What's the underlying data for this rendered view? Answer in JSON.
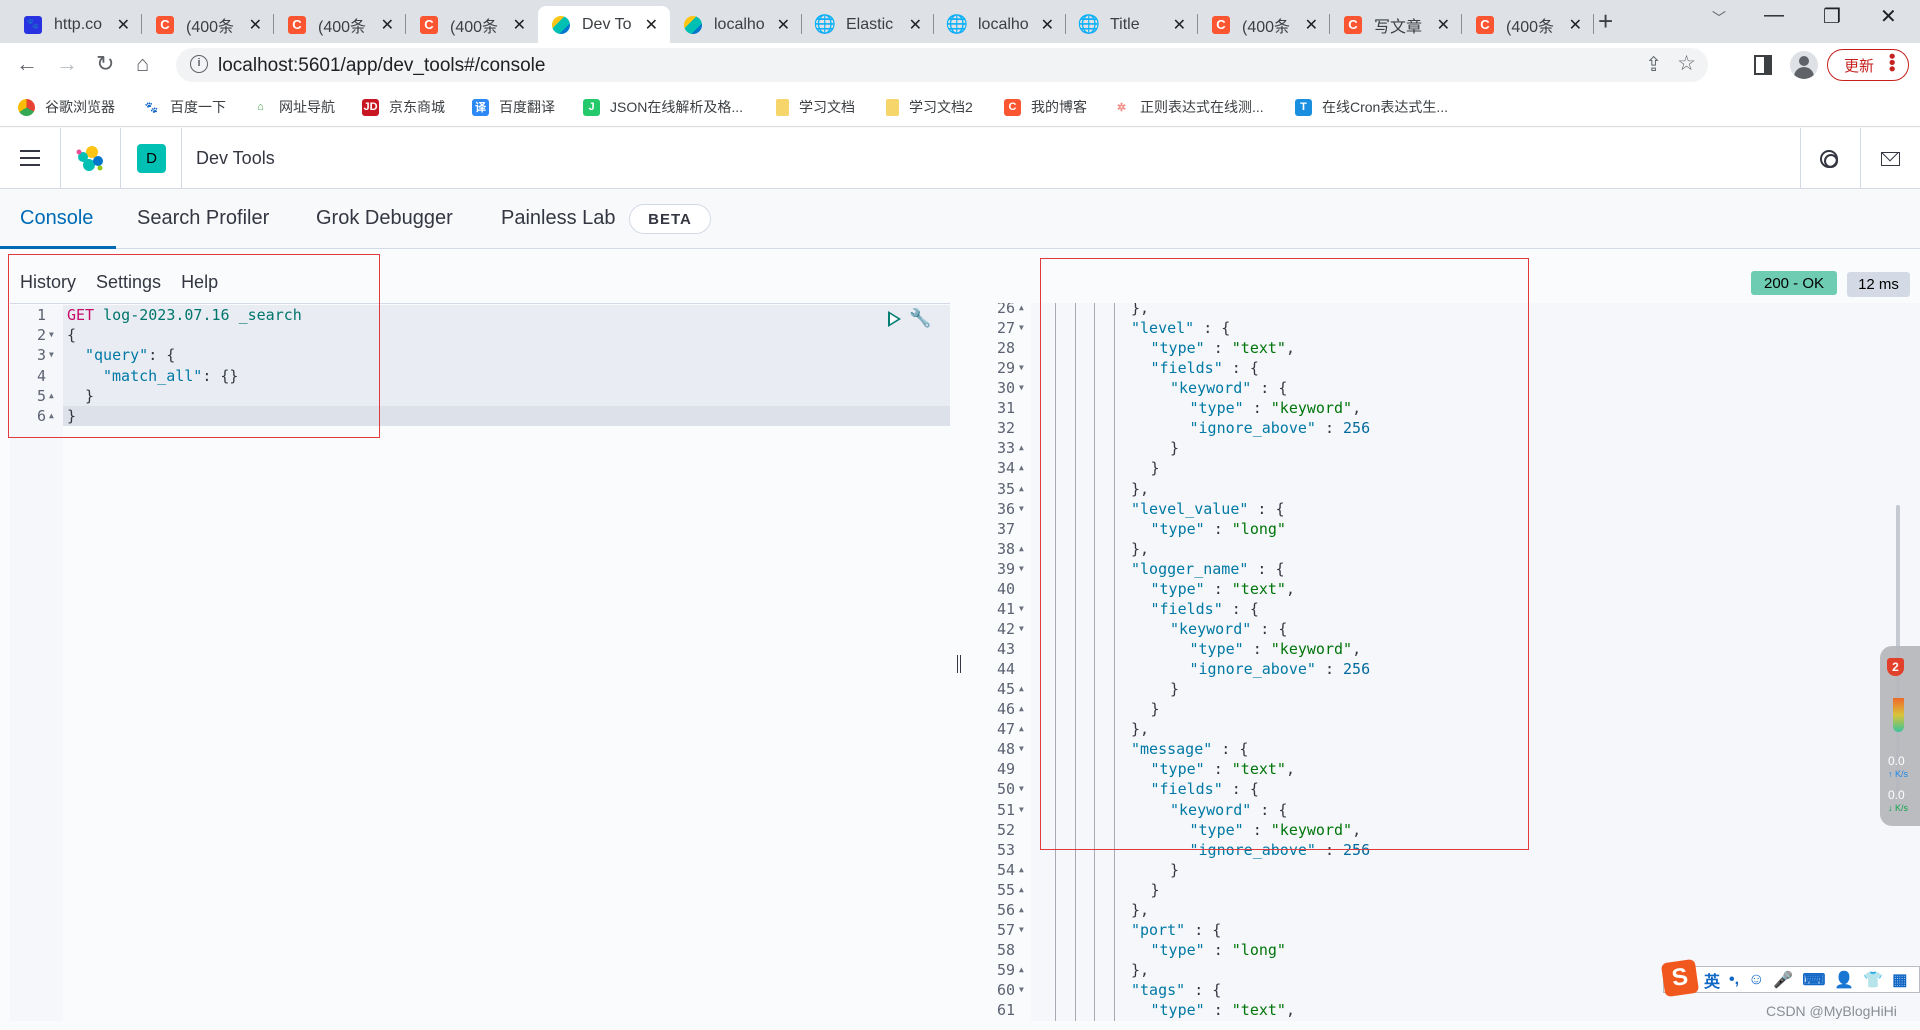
{
  "browser": {
    "tabs": [
      {
        "title": "http.co",
        "icon": "baidu-paw-icon"
      },
      {
        "title": "(400条",
        "icon": "csdn-icon"
      },
      {
        "title": "(400条",
        "icon": "csdn-icon"
      },
      {
        "title": "(400条",
        "icon": "csdn-icon"
      },
      {
        "title": "Dev To",
        "icon": "elastic-icon",
        "active": true
      },
      {
        "title": "localho",
        "icon": "elastic-icon"
      },
      {
        "title": "Elastic",
        "icon": "globe-icon"
      },
      {
        "title": "localho",
        "icon": "globe-icon"
      },
      {
        "title": "Title",
        "icon": "globe-icon"
      },
      {
        "title": "(400条",
        "icon": "csdn-icon"
      },
      {
        "title": "写文章",
        "icon": "csdn-icon"
      },
      {
        "title": "(400条",
        "icon": "csdn-icon"
      }
    ],
    "close_glyph": "✕",
    "new_tab_glyph": "+",
    "url": "localhost:5601/app/dev_tools#/console",
    "update_label": "更新",
    "bookmarks": [
      {
        "label": "谷歌浏览器",
        "icon": "chrome-icon",
        "color": "#e94235"
      },
      {
        "label": "百度一下",
        "icon": "baidu-paw-icon",
        "color": "#2932e1"
      },
      {
        "label": "网址导航",
        "icon": "2345-icon",
        "color": "#3fa34d"
      },
      {
        "label": "京东商城",
        "icon": "jd-icon",
        "color": "#c91623"
      },
      {
        "label": "百度翻译",
        "icon": "translate-icon",
        "color": "#2b88f5"
      },
      {
        "label": "JSON在线解析及格...",
        "icon": "json-icon",
        "color": "#23c96a"
      },
      {
        "label": "学习文档",
        "icon": "folder-icon",
        "color": "#f6d56b"
      },
      {
        "label": "学习文档2",
        "icon": "folder-icon",
        "color": "#f6d56b"
      },
      {
        "label": "我的博客",
        "icon": "csdn-icon",
        "color": "#fc5531"
      },
      {
        "label": "正则表达式在线测...",
        "icon": "regex-icon",
        "color": "#f08a80"
      },
      {
        "label": "在线Cron表达式生...",
        "icon": "cron-icon",
        "color": "#1a8fe0"
      }
    ]
  },
  "kibana": {
    "space_initial": "D",
    "app_title": "Dev Tools",
    "tabs": [
      {
        "label": "Console",
        "active": true
      },
      {
        "label": "Search Profiler"
      },
      {
        "label": "Grok Debugger"
      },
      {
        "label": "Painless Lab"
      }
    ],
    "beta_label": "BETA",
    "menu": [
      "History",
      "Settings",
      "Help"
    ],
    "status": {
      "code_label": "200 - OK",
      "time_label": "12 ms",
      "ok_color": "#6dccb1"
    }
  },
  "request": {
    "lines": [
      {
        "n": "1",
        "fold": "",
        "indent": 0,
        "tokens": [
          {
            "t": "GET ",
            "c": "kw-method"
          },
          {
            "t": "log-2023.07.16 _search",
            "c": "kw-url"
          }
        ]
      },
      {
        "n": "2",
        "fold": "▼",
        "indent": 0,
        "tokens": [
          {
            "t": "{",
            "c": ""
          }
        ]
      },
      {
        "n": "3",
        "fold": "▼",
        "indent": 1,
        "tokens": [
          {
            "t": "\"query\"",
            "c": "kw-key"
          },
          {
            "t": ": {",
            "c": ""
          }
        ]
      },
      {
        "n": "4",
        "fold": "",
        "indent": 2,
        "tokens": [
          {
            "t": "\"match_all\"",
            "c": "kw-key"
          },
          {
            "t": ": {}",
            "c": ""
          }
        ]
      },
      {
        "n": "5",
        "fold": "▲",
        "indent": 1,
        "tokens": [
          {
            "t": "}",
            "c": ""
          }
        ]
      },
      {
        "n": "6",
        "fold": "▲",
        "indent": 0,
        "tokens": [
          {
            "t": "}",
            "c": ""
          }
        ]
      }
    ]
  },
  "response": {
    "lines": [
      {
        "n": "26",
        "fold": "▲",
        "indent": 4,
        "tokens": [
          {
            "t": "},",
            "c": ""
          }
        ]
      },
      {
        "n": "27",
        "fold": "▼",
        "indent": 4,
        "tokens": [
          {
            "t": "\"level\"",
            "c": "kw-key"
          },
          {
            "t": " : {",
            "c": ""
          }
        ]
      },
      {
        "n": "28",
        "fold": "",
        "indent": 5,
        "tokens": [
          {
            "t": "\"type\"",
            "c": "kw-key"
          },
          {
            "t": " : ",
            "c": ""
          },
          {
            "t": "\"text\"",
            "c": "kw-str"
          },
          {
            "t": ",",
            "c": ""
          }
        ]
      },
      {
        "n": "29",
        "fold": "▼",
        "indent": 5,
        "tokens": [
          {
            "t": "\"fields\"",
            "c": "kw-key"
          },
          {
            "t": " : {",
            "c": ""
          }
        ]
      },
      {
        "n": "30",
        "fold": "▼",
        "indent": 6,
        "tokens": [
          {
            "t": "\"keyword\"",
            "c": "kw-key"
          },
          {
            "t": " : {",
            "c": ""
          }
        ]
      },
      {
        "n": "31",
        "fold": "",
        "indent": 7,
        "tokens": [
          {
            "t": "\"type\"",
            "c": "kw-key"
          },
          {
            "t": " : ",
            "c": ""
          },
          {
            "t": "\"keyword\"",
            "c": "kw-str"
          },
          {
            "t": ",",
            "c": ""
          }
        ]
      },
      {
        "n": "32",
        "fold": "",
        "indent": 7,
        "tokens": [
          {
            "t": "\"ignore_above\"",
            "c": "kw-key"
          },
          {
            "t": " : ",
            "c": ""
          },
          {
            "t": "256",
            "c": "kw-num"
          }
        ]
      },
      {
        "n": "33",
        "fold": "▲",
        "indent": 6,
        "tokens": [
          {
            "t": "}",
            "c": ""
          }
        ]
      },
      {
        "n": "34",
        "fold": "▲",
        "indent": 5,
        "tokens": [
          {
            "t": "}",
            "c": ""
          }
        ]
      },
      {
        "n": "35",
        "fold": "▲",
        "indent": 4,
        "tokens": [
          {
            "t": "},",
            "c": ""
          }
        ]
      },
      {
        "n": "36",
        "fold": "▼",
        "indent": 4,
        "tokens": [
          {
            "t": "\"level_value\"",
            "c": "kw-key"
          },
          {
            "t": " : {",
            "c": ""
          }
        ]
      },
      {
        "n": "37",
        "fold": "",
        "indent": 5,
        "tokens": [
          {
            "t": "\"type\"",
            "c": "kw-key"
          },
          {
            "t": " : ",
            "c": ""
          },
          {
            "t": "\"long\"",
            "c": "kw-str"
          }
        ]
      },
      {
        "n": "38",
        "fold": "▲",
        "indent": 4,
        "tokens": [
          {
            "t": "},",
            "c": ""
          }
        ]
      },
      {
        "n": "39",
        "fold": "▼",
        "indent": 4,
        "tokens": [
          {
            "t": "\"logger_name\"",
            "c": "kw-key"
          },
          {
            "t": " : {",
            "c": ""
          }
        ]
      },
      {
        "n": "40",
        "fold": "",
        "indent": 5,
        "tokens": [
          {
            "t": "\"type\"",
            "c": "kw-key"
          },
          {
            "t": " : ",
            "c": ""
          },
          {
            "t": "\"text\"",
            "c": "kw-str"
          },
          {
            "t": ",",
            "c": ""
          }
        ]
      },
      {
        "n": "41",
        "fold": "▼",
        "indent": 5,
        "tokens": [
          {
            "t": "\"fields\"",
            "c": "kw-key"
          },
          {
            "t": " : {",
            "c": ""
          }
        ]
      },
      {
        "n": "42",
        "fold": "▼",
        "indent": 6,
        "tokens": [
          {
            "t": "\"keyword\"",
            "c": "kw-key"
          },
          {
            "t": " : {",
            "c": ""
          }
        ]
      },
      {
        "n": "43",
        "fold": "",
        "indent": 7,
        "tokens": [
          {
            "t": "\"type\"",
            "c": "kw-key"
          },
          {
            "t": " : ",
            "c": ""
          },
          {
            "t": "\"keyword\"",
            "c": "kw-str"
          },
          {
            "t": ",",
            "c": ""
          }
        ]
      },
      {
        "n": "44",
        "fold": "",
        "indent": 7,
        "tokens": [
          {
            "t": "\"ignore_above\"",
            "c": "kw-key"
          },
          {
            "t": " : ",
            "c": ""
          },
          {
            "t": "256",
            "c": "kw-num"
          }
        ]
      },
      {
        "n": "45",
        "fold": "▲",
        "indent": 6,
        "tokens": [
          {
            "t": "}",
            "c": ""
          }
        ]
      },
      {
        "n": "46",
        "fold": "▲",
        "indent": 5,
        "tokens": [
          {
            "t": "}",
            "c": ""
          }
        ]
      },
      {
        "n": "47",
        "fold": "▲",
        "indent": 4,
        "tokens": [
          {
            "t": "},",
            "c": ""
          }
        ]
      },
      {
        "n": "48",
        "fold": "▼",
        "indent": 4,
        "tokens": [
          {
            "t": "\"message\"",
            "c": "kw-key"
          },
          {
            "t": " : {",
            "c": ""
          }
        ]
      },
      {
        "n": "49",
        "fold": "",
        "indent": 5,
        "tokens": [
          {
            "t": "\"type\"",
            "c": "kw-key"
          },
          {
            "t": " : ",
            "c": ""
          },
          {
            "t": "\"text\"",
            "c": "kw-str"
          },
          {
            "t": ",",
            "c": ""
          }
        ]
      },
      {
        "n": "50",
        "fold": "▼",
        "indent": 5,
        "tokens": [
          {
            "t": "\"fields\"",
            "c": "kw-key"
          },
          {
            "t": " : {",
            "c": ""
          }
        ]
      },
      {
        "n": "51",
        "fold": "▼",
        "indent": 6,
        "tokens": [
          {
            "t": "\"keyword\"",
            "c": "kw-key"
          },
          {
            "t": " : {",
            "c": ""
          }
        ]
      },
      {
        "n": "52",
        "fold": "",
        "indent": 7,
        "tokens": [
          {
            "t": "\"type\"",
            "c": "kw-key"
          },
          {
            "t": " : ",
            "c": ""
          },
          {
            "t": "\"keyword\"",
            "c": "kw-str"
          },
          {
            "t": ",",
            "c": ""
          }
        ]
      },
      {
        "n": "53",
        "fold": "",
        "indent": 7,
        "tokens": [
          {
            "t": "\"ignore_above\"",
            "c": "kw-key"
          },
          {
            "t": " : ",
            "c": ""
          },
          {
            "t": "256",
            "c": "kw-num"
          }
        ]
      },
      {
        "n": "54",
        "fold": "▲",
        "indent": 6,
        "tokens": [
          {
            "t": "}",
            "c": ""
          }
        ]
      },
      {
        "n": "55",
        "fold": "▲",
        "indent": 5,
        "tokens": [
          {
            "t": "}",
            "c": ""
          }
        ]
      },
      {
        "n": "56",
        "fold": "▲",
        "indent": 4,
        "tokens": [
          {
            "t": "},",
            "c": ""
          }
        ]
      },
      {
        "n": "57",
        "fold": "▼",
        "indent": 4,
        "tokens": [
          {
            "t": "\"port\"",
            "c": "kw-key"
          },
          {
            "t": " : {",
            "c": ""
          }
        ]
      },
      {
        "n": "58",
        "fold": "",
        "indent": 5,
        "tokens": [
          {
            "t": "\"type\"",
            "c": "kw-key"
          },
          {
            "t": " : ",
            "c": ""
          },
          {
            "t": "\"long\"",
            "c": "kw-str"
          }
        ]
      },
      {
        "n": "59",
        "fold": "▲",
        "indent": 4,
        "tokens": [
          {
            "t": "},",
            "c": ""
          }
        ]
      },
      {
        "n": "60",
        "fold": "▼",
        "indent": 4,
        "tokens": [
          {
            "t": "\"tags\"",
            "c": "kw-key"
          },
          {
            "t": " : {",
            "c": ""
          }
        ]
      },
      {
        "n": "61",
        "fold": "",
        "indent": 5,
        "tokens": [
          {
            "t": "\"type\"",
            "c": "kw-key"
          },
          {
            "t": " : ",
            "c": ""
          },
          {
            "t": "\"text\"",
            "c": "kw-str"
          },
          {
            "t": ",",
            "c": ""
          }
        ]
      }
    ]
  },
  "overlays": {
    "net_widget": {
      "badge": "2",
      "up": "0.0",
      "down": "0.0",
      "unit": "K/s"
    },
    "ime_items": [
      "英",
      "•,",
      "☺",
      "🎤",
      "⌨",
      "👤",
      "👕",
      "▦"
    ],
    "watermark": "CSDN @MyBlogHiHi"
  }
}
